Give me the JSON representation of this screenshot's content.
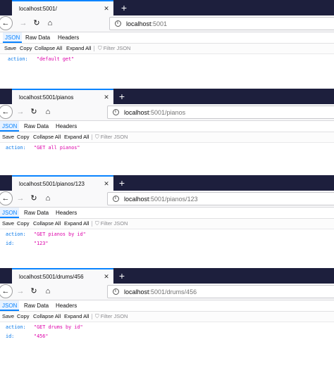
{
  "viewer": {
    "tabs": [
      "JSON",
      "Raw Data",
      "Headers"
    ],
    "toolbar": [
      "Save",
      "Copy",
      "Collapse All",
      "Expand All"
    ],
    "filter_placeholder": "Filter JSON"
  },
  "colors": {
    "tabbar_bg": "#1d1f3d",
    "accent": "#0a84ff",
    "json_key": "#0074e8",
    "json_string": "#dd00a9"
  },
  "icons": [
    "back-arrow-icon",
    "forward-arrow-icon",
    "reload-icon",
    "home-icon",
    "close-icon",
    "new-tab-plus-icon",
    "info-icon",
    "filter-funnel-icon"
  ],
  "windows": [
    {
      "tab_title": "localhost:5001/",
      "url_host": "localhost",
      "url_rest": ":5001",
      "json": [
        {
          "key": "action:",
          "value": "\"default get\""
        }
      ]
    },
    {
      "tab_title": "localhost:5001/pianos",
      "url_host": "localhost",
      "url_rest": ":5001/pianos",
      "json": [
        {
          "key": "action:",
          "value": "\"GET all pianos\""
        }
      ]
    },
    {
      "tab_title": "localhost:5001/pianos/123",
      "url_host": "localhost",
      "url_rest": ":5001/pianos/123",
      "json": [
        {
          "key": "action:",
          "value": "\"GET pianos by id\""
        },
        {
          "key": "id:",
          "value": "\"123\""
        }
      ]
    },
    {
      "tab_title": "localhost:5001/drums/456",
      "url_host": "localhost",
      "url_rest": ":5001/drums/456",
      "json": [
        {
          "key": "action:",
          "value": "\"GET drums by id\""
        },
        {
          "key": "id:",
          "value": "\"456\""
        }
      ]
    }
  ]
}
